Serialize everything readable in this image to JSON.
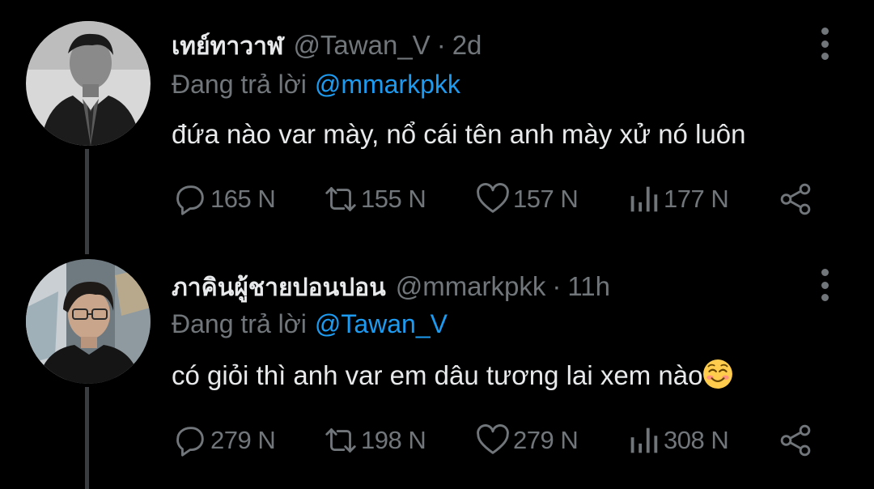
{
  "theme": {
    "background": "#000000",
    "text": "#e7e9ea",
    "muted": "#71767b",
    "link": "#1d9bf0",
    "thread_line": "#3a3d40"
  },
  "tweets": [
    {
      "display_name": "เทย์ทาวาฬ",
      "handle": "@Tawan_V",
      "separator": "·",
      "time": "2d",
      "replying_label": "Đang trả lời",
      "replying_to": "@mmarkpkk",
      "text": "đứa nào var mày, nổ cái tên anh mày xử nó luôn",
      "avatar_icon": "avatar-photo-man-in-suit-grayscale",
      "stats": {
        "replies": "165 N",
        "retweets": "155 N",
        "likes": "157 N",
        "views": "177 N"
      }
    },
    {
      "display_name": "ภาคินผู้ชายปอนปอน",
      "handle": "@mmarkpkk",
      "separator": "·",
      "time": "11h",
      "replying_label": "Đang trả lời",
      "replying_to": "@Tawan_V",
      "text": "có giỏi thì anh var em dâu tương lai xem nào",
      "emoji": "smiling-face-emoji",
      "avatar_icon": "avatar-photo-young-man-glasses",
      "stats": {
        "replies": "279 N",
        "retweets": "198 N",
        "likes": "279 N",
        "views": "308 N"
      }
    }
  ]
}
